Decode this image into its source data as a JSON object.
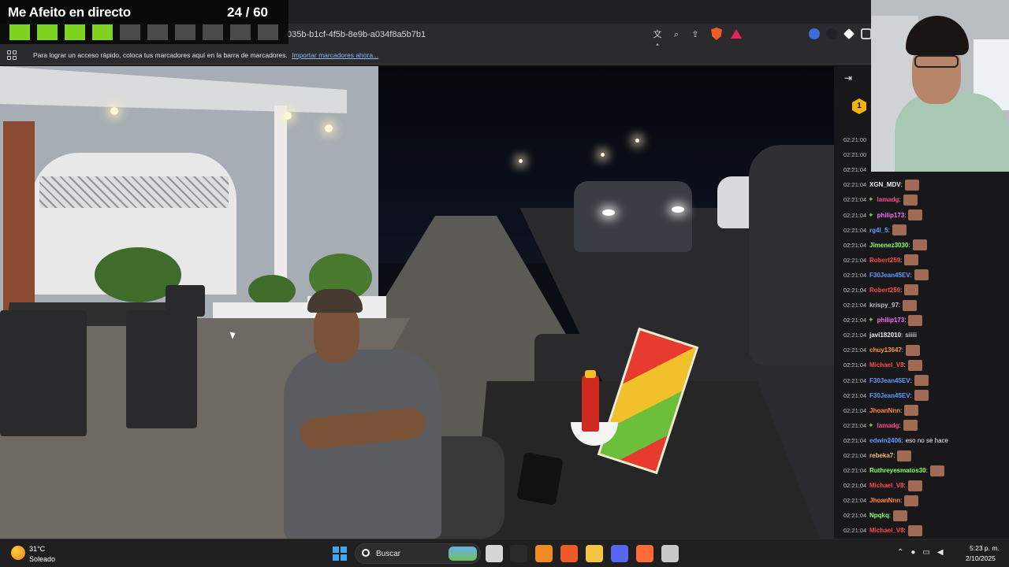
{
  "challenge": {
    "title": "Me Afeito en directo",
    "counter": "24 / 60",
    "boxes": {
      "total": 10,
      "completed": 4
    }
  },
  "browser": {
    "url": "035b-b1cf-4f5b-8e9b-a034f8a5b7b1",
    "bookmarks_bar_text": "Para lograr un acceso rápido, coloca tus marcadores aquí en la barra de marcadores.",
    "bookmarks_import_link": "Importar marcadores ahora...",
    "icons": [
      "translate-icon",
      "zoom-icon",
      "share-icon",
      "brave-shield-icon",
      "brave-rewards-icon"
    ]
  },
  "chat": {
    "badge_number": "1",
    "messages": [
      {
        "time": "02:21:00",
        "user": "",
        "color": "#9146ff",
        "text": "",
        "emote": false,
        "star": false
      },
      {
        "time": "02:21:00",
        "user": "",
        "color": "#5c9dff",
        "text": "",
        "emote": false,
        "star": false
      },
      {
        "time": "02:21:04",
        "user": "",
        "color": "#bdbdc2",
        "text": "",
        "emote": false,
        "star": false
      },
      {
        "time": "02:21:04",
        "user": "XGN_MDV",
        "color": "#efeff1",
        "text": "",
        "emote": true,
        "star": false
      },
      {
        "time": "02:21:04",
        "user": "lamadg",
        "color": "#ff4a8d",
        "text": "",
        "emote": true,
        "star": true
      },
      {
        "time": "02:21:04",
        "user": "philip173",
        "color": "#ff6bff",
        "text": "",
        "emote": true,
        "star": true
      },
      {
        "time": "02:21:04",
        "user": "rg4l_5",
        "color": "#5c9dff",
        "text": "",
        "emote": true,
        "star": false
      },
      {
        "time": "02:21:04",
        "user": "Jimenez3030",
        "color": "#8cff6b",
        "text": "",
        "emote": true,
        "star": false
      },
      {
        "time": "02:21:04",
        "user": "Robert259",
        "color": "#ff4a4a",
        "text": "",
        "emote": true,
        "star": false
      },
      {
        "time": "02:21:04",
        "user": "F30Jean45EV",
        "color": "#5c9dff",
        "text": "",
        "emote": true,
        "star": false
      },
      {
        "time": "02:21:04",
        "user": "Robert259",
        "color": "#ff4a4a",
        "text": "",
        "emote": true,
        "star": false
      },
      {
        "time": "02:21:04",
        "user": "krispy_97",
        "color": "#bdbdc2",
        "text": "",
        "emote": true,
        "star": false
      },
      {
        "time": "02:21:04",
        "user": "philip173",
        "color": "#ff6bff",
        "text": "",
        "emote": true,
        "star": true
      },
      {
        "time": "02:21:04",
        "user": "javi182010",
        "color": "#efeff1",
        "text": "siiiiii",
        "emote": false,
        "star": false
      },
      {
        "time": "02:21:04",
        "user": "chuy13647",
        "color": "#ff9a3c",
        "text": "",
        "emote": true,
        "star": false
      },
      {
        "time": "02:21:04",
        "user": "Michael_V8",
        "color": "#ff4a4a",
        "text": "",
        "emote": true,
        "star": false
      },
      {
        "time": "02:21:04",
        "user": "F30Jean45EV",
        "color": "#5c9dff",
        "text": "",
        "emote": true,
        "star": false
      },
      {
        "time": "02:21:04",
        "user": "F30Jean45EV",
        "color": "#5c9dff",
        "text": "",
        "emote": true,
        "star": false
      },
      {
        "time": "02:21:04",
        "user": "JhoanNnn",
        "color": "#ff8a3c",
        "text": "",
        "emote": true,
        "star": false
      },
      {
        "time": "02:21:04",
        "user": "lamadg",
        "color": "#ff4a8d",
        "text": "",
        "emote": true,
        "star": true
      },
      {
        "time": "02:21:04",
        "user": "edwin2406",
        "color": "#5c9dff",
        "text": "eso no se hace",
        "emote": false,
        "star": false
      },
      {
        "time": "02:21:04",
        "user": "rebeka7",
        "color": "#ffb86b",
        "text": "",
        "emote": true,
        "star": false
      },
      {
        "time": "02:21:04",
        "user": "Ruthreyesmatos30",
        "color": "#8cff6b",
        "text": "",
        "emote": true,
        "star": false
      },
      {
        "time": "02:21:04",
        "user": "Michael_V8",
        "color": "#ff4a4a",
        "text": "",
        "emote": true,
        "star": false
      },
      {
        "time": "02:21:04",
        "user": "JhoanNnn",
        "color": "#ff8a3c",
        "text": "",
        "emote": true,
        "star": false
      },
      {
        "time": "02:21:04",
        "user": "Npqkq",
        "color": "#8cff6b",
        "text": "",
        "emote": true,
        "star": false
      },
      {
        "time": "02:21:04",
        "user": "Michael_V8",
        "color": "#ff4a4a",
        "text": "",
        "emote": true,
        "star": false
      }
    ]
  },
  "taskbar": {
    "weather_temp": "31°C",
    "weather_condition": "Soleado",
    "search_placeholder": "Buscar",
    "time": "5:23 p. m.",
    "date": "2/10/2025",
    "apps": [
      {
        "name": "task-view-icon",
        "color": "#d6d6d6"
      },
      {
        "name": "epic-games-icon",
        "color": "#2a2a2a"
      },
      {
        "name": "vlc-icon",
        "color": "#f08a24"
      },
      {
        "name": "brave-icon",
        "color": "#f05a28"
      },
      {
        "name": "file-explorer-icon",
        "color": "#f4c542"
      },
      {
        "name": "discord-icon",
        "color": "#5865f2"
      },
      {
        "name": "app-orange-icon",
        "color": "#ff6b35"
      },
      {
        "name": "steam-icon",
        "color": "#c9c9c9"
      }
    ]
  }
}
